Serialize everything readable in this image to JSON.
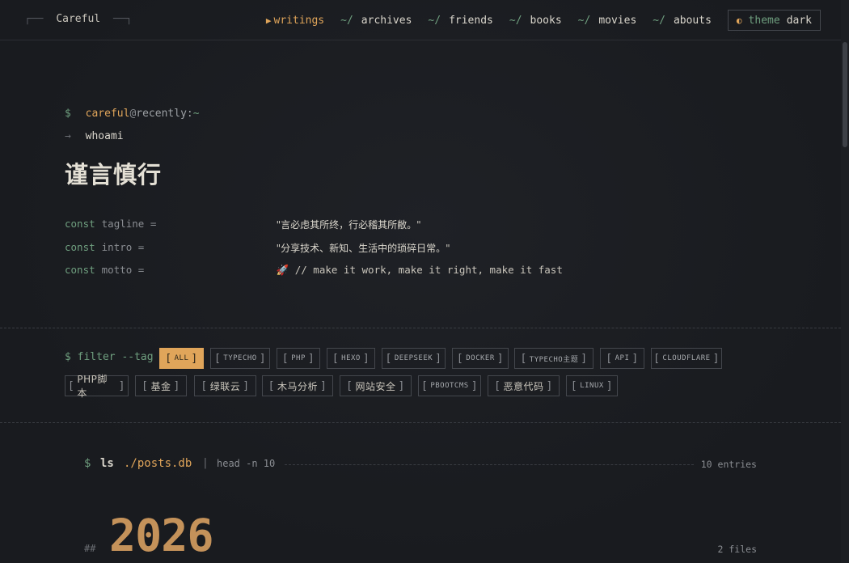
{
  "header": {
    "brand": "Careful",
    "nav": [
      {
        "label": "writings",
        "active": true
      },
      {
        "label": "archives",
        "active": false
      },
      {
        "label": "friends",
        "active": false
      },
      {
        "label": "books",
        "active": false
      },
      {
        "label": "movies",
        "active": false
      },
      {
        "label": "abouts",
        "active": false
      }
    ],
    "nav_prefix": "~/",
    "theme": {
      "word": "theme",
      "value": "dark"
    }
  },
  "hero": {
    "dollar": "$",
    "user": "careful",
    "at": "@",
    "host": "recently:",
    "path": "~",
    "cmd_arrow": "→",
    "cmd": "whoami",
    "title": "谨言慎行",
    "consts": [
      {
        "kw": "const",
        "name": "tagline =",
        "value": "\"言必虑其所终，行必稽其所敝。\""
      },
      {
        "kw": "const",
        "name": "intro =",
        "value": "\"分享技术、新知、生活中的琐碎日常。\""
      },
      {
        "kw": "const",
        "name": "motto =",
        "value": "🚀 // make it work, make it right, make it fast"
      }
    ]
  },
  "filter": {
    "label": "$ filter --tag",
    "tags": [
      "ALL",
      "TYPECHO",
      "PHP",
      "HEXO",
      "DEEPSEEK",
      "DOCKER",
      "TYPECHO主题",
      "API",
      "CLOUDFLARE",
      "PHP脚本",
      "基金",
      "绿联云",
      "木马分析",
      "网站安全",
      "PBOOTCMS",
      "恶意代码",
      "LINUX"
    ],
    "active": "ALL"
  },
  "listing": {
    "dollar": "$",
    "cmd": "ls",
    "file": "./posts.db",
    "pipe": "|",
    "head": "head -n 10",
    "entries": "10 entries"
  },
  "year_group": {
    "hash": "##",
    "year": "2026",
    "files": "2 files"
  }
}
